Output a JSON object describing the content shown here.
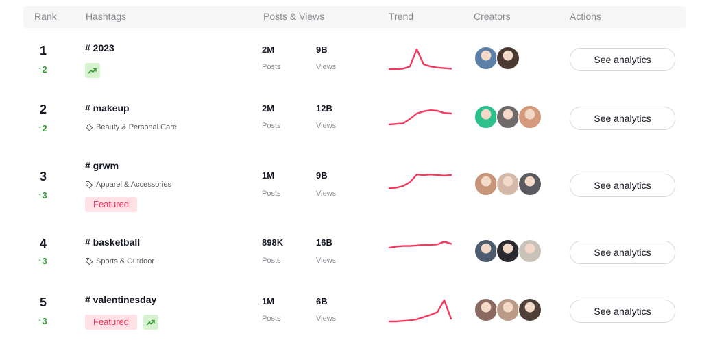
{
  "header": {
    "rank": "Rank",
    "hashtags": "Hashtags",
    "posts_views": "Posts & Views",
    "trend": "Trend",
    "creators": "Creators",
    "actions": "Actions"
  },
  "colors": {
    "trend_line": "#f23a5e",
    "rank_up": "#3b9c3b",
    "featured_text": "#ea3158",
    "featured_bg": "#ffe1e6",
    "trend_badge_bg": "#d7f2cf"
  },
  "rows": [
    {
      "rank": "1",
      "change": "2",
      "hashtag": "# 2023",
      "category": "",
      "featured": "",
      "trending_icon": "trending-up-icon",
      "posts": "2M",
      "posts_label": "Posts",
      "views": "9B",
      "views_label": "Views",
      "trend": [
        12,
        12,
        14,
        22,
        85,
        30,
        22,
        18,
        16,
        14
      ],
      "avatars": [
        "#5b7fa6",
        "#4a3a32"
      ],
      "action": "See analytics"
    },
    {
      "rank": "2",
      "change": "2",
      "hashtag": "# makeup",
      "category": "Beauty & Personal Care",
      "featured": "",
      "trending_icon": "",
      "posts": "2M",
      "posts_label": "Posts",
      "views": "12B",
      "views_label": "Views",
      "trend": [
        10,
        12,
        14,
        30,
        50,
        58,
        62,
        60,
        52,
        50
      ],
      "avatars": [
        "#2dbf8c",
        "#6f6a6a",
        "#d39a7c"
      ],
      "action": "See analytics"
    },
    {
      "rank": "3",
      "change": "3",
      "hashtag": "# grwm",
      "category": "Apparel & Accessories",
      "featured": "Featured",
      "trending_icon": "",
      "posts": "1M",
      "posts_label": "Posts",
      "views": "9B",
      "views_label": "Views",
      "trend": [
        12,
        14,
        20,
        34,
        62,
        60,
        62,
        60,
        58,
        60
      ],
      "avatars": [
        "#c69579",
        "#d4b9a8",
        "#5a5a60"
      ],
      "action": "See analytics"
    },
    {
      "rank": "4",
      "change": "3",
      "hashtag": "# basketball",
      "category": "Sports & Outdoor",
      "featured": "",
      "trending_icon": "",
      "posts": "898K",
      "posts_label": "Posts",
      "views": "16B",
      "views_label": "Views",
      "trend": [
        40,
        44,
        46,
        46,
        48,
        50,
        50,
        52,
        62,
        54
      ],
      "avatars": [
        "#4d5b6e",
        "#2a2a2e",
        "#c9c2b8"
      ],
      "action": "See analytics"
    },
    {
      "rank": "5",
      "change": "3",
      "hashtag": "# valentinesday",
      "category": "",
      "featured": "Featured",
      "trending_icon": "trending-up-icon",
      "posts": "1M",
      "posts_label": "Posts",
      "views": "6B",
      "views_label": "Views",
      "trend": [
        10,
        10,
        12,
        14,
        18,
        26,
        34,
        44,
        88,
        20
      ],
      "avatars": [
        "#8a6a60",
        "#b89a86",
        "#4e4038"
      ],
      "action": "See analytics"
    }
  ]
}
